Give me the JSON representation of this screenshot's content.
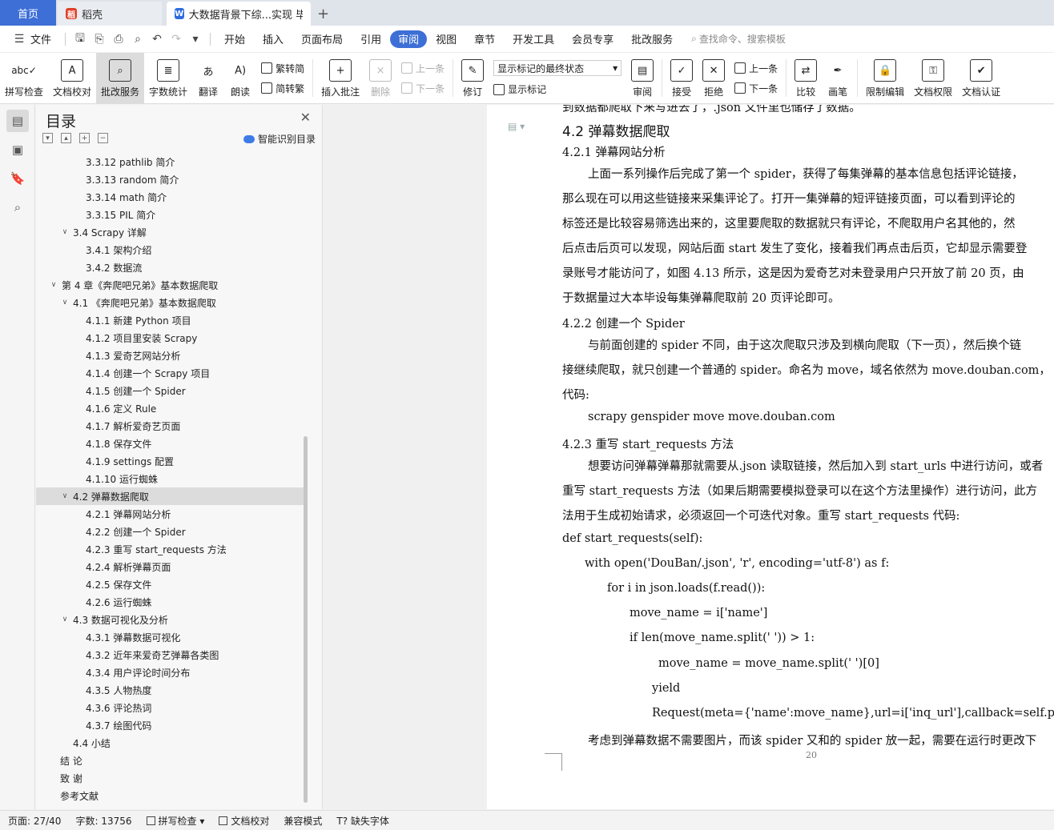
{
  "tabs": {
    "home": "首页",
    "docer": "稻壳",
    "active": "大数据背景下综...实现 毕业论"
  },
  "menu": {
    "file": "文件",
    "items": [
      "开始",
      "插入",
      "页面布局",
      "引用",
      "审阅",
      "视图",
      "章节",
      "开发工具",
      "会员专享",
      "批改服务"
    ],
    "active_index": 4,
    "search_placeholder": "查找命令、搜索模板"
  },
  "ribbon": {
    "spellcheck": "拼写检查",
    "doc_check": "文档校对",
    "review_service": "批改服务",
    "word_count": "字数统计",
    "translate": "翻译",
    "read_aloud": "朗读",
    "trad_to_simp": "繁转简",
    "simp_to_trad": "简转繁",
    "insert_comment": "插入批注",
    "delete": "删除",
    "prev_comment": "上一条",
    "next_comment": "下一条",
    "revise": "修订",
    "display_mode": "显示标记的最终状态",
    "show_marks": "显示标记",
    "review": "审阅",
    "accept": "接受",
    "reject": "拒绝",
    "prev_change": "上一条",
    "next_change": "下一条",
    "compare": "比较",
    "pen": "画笔",
    "restrict_edit": "限制编辑",
    "doc_permission": "文档权限",
    "doc_cert": "文档认证"
  },
  "toc": {
    "title": "目录",
    "smart": "智能识别目录",
    "items": [
      {
        "label": "3.3.12 pathlib 简介",
        "level": 3
      },
      {
        "label": "3.3.13 random 简介",
        "level": 3
      },
      {
        "label": "3.3.14 math 简介",
        "level": 3
      },
      {
        "label": "3.3.15 PIL 简介",
        "level": 3
      },
      {
        "label": "3.4 Scrapy 详解",
        "level": 2,
        "expanded": true
      },
      {
        "label": "3.4.1  架构介绍",
        "level": 3
      },
      {
        "label": "3.4.2  数据流",
        "level": 3
      },
      {
        "label": "第 4 章《奔爬吧兄弟》基本数据爬取",
        "level": 1,
        "expanded": true
      },
      {
        "label": "4.1 《奔爬吧兄弟》基本数据爬取",
        "level": 2,
        "expanded": true
      },
      {
        "label": "4.1.1  新建 Python 项目",
        "level": 3
      },
      {
        "label": "4.1.2  项目里安装 Scrapy",
        "level": 3
      },
      {
        "label": "4.1.3  爱奇艺网站分析",
        "level": 3
      },
      {
        "label": "4.1.4  创建一个 Scrapy 项目",
        "level": 3
      },
      {
        "label": "4.1.5  创建一个 Spider",
        "level": 3
      },
      {
        "label": "4.1.6  定义 Rule",
        "level": 3
      },
      {
        "label": "4.1.7  解析爱奇艺页面",
        "level": 3
      },
      {
        "label": "4.1.8  保存文件",
        "level": 3
      },
      {
        "label": "4.1.9  settings 配置",
        "level": 3
      },
      {
        "label": "4.1.10  运行蜘蛛",
        "level": 3
      },
      {
        "label": "4.2  弹幕数据爬取",
        "level": 2,
        "expanded": true,
        "selected": true
      },
      {
        "label": "4.2.1  弹幕网站分析",
        "level": 3
      },
      {
        "label": "4.2.2  创建一个 Spider",
        "level": 3
      },
      {
        "label": "4.2.3  重写 start_requests 方法",
        "level": 3
      },
      {
        "label": "4.2.4  解析弹幕页面",
        "level": 3
      },
      {
        "label": "4.2.5  保存文件",
        "level": 3
      },
      {
        "label": "4.2.6  运行蜘蛛",
        "level": 3
      },
      {
        "label": "4.3  数据可视化及分析",
        "level": 2,
        "expanded": true
      },
      {
        "label": "4.3.1  弹幕数据可视化",
        "level": 3
      },
      {
        "label": "4.3.2  近年来爱奇艺弹幕各类图",
        "level": 3
      },
      {
        "label": "4.3.4  用户评论时间分布",
        "level": 3
      },
      {
        "label": "4.3.5  人物热度",
        "level": 3
      },
      {
        "label": "4.3.6  评论热词",
        "level": 3
      },
      {
        "label": "4.3.7  绘图代码",
        "level": 3
      },
      {
        "label": "4.4  小结",
        "level": 2
      },
      {
        "label": "结  论",
        "level": 1
      },
      {
        "label": "致  谢",
        "level": 1
      },
      {
        "label": "参考文献",
        "level": 1
      }
    ]
  },
  "doc": {
    "top_cut": "到数据都爬取下来写进去了，.json 文件里也储存了数据。",
    "h2": "4.2  弹幕数据爬取",
    "h3_1": "4.2.1    弹幕网站分析",
    "para1": [
      "上面一系列操作后完成了第一个 spider，获得了每集弹幕的基本信息包括评论链接，",
      "那么现在可以用这些链接来采集评论了。打开一集弹幕的短评链接页面，可以看到评论的",
      "标签还是比较容易筛选出来的，这里要爬取的数据就只有评论，不爬取用户名其他的，然",
      "后点击后页可以发现，网站后面 start 发生了变化，接着我们再点击后页，它却显示需要登",
      "录账号才能访问了，如图 4.13 所示，这是因为爱奇艺对未登录用户只开放了前 20 页，由",
      "于数据量过大本毕设每集弹幕爬取前 20 页评论即可。"
    ],
    "h3_2": "4.2.2    创建一个 Spider",
    "para2": [
      "与前面创建的 spider 不同，由于这次爬取只涉及到横向爬取（下一页），然后换个链",
      "接继续爬取，就只创建一个普通的 spider。命名为 move，域名依然为 move.douban.com，",
      "代码:"
    ],
    "cmd": "scrapy genspider move move.douban.com",
    "h3_3": "4.2.3    重写 start_requests 方法",
    "para3": [
      "想要访问弹幕弹幕那就需要从.json 读取链接，然后加入到 start_urls 中进行访问，或者",
      "重写 start_requests 方法（如果后期需要模拟登录可以在这个方法里操作）进行访问，此方",
      "法用于生成初始请求，必须返回一个可迭代对象。重写 start_requests 代码:"
    ],
    "code": [
      "def start_requests(self):",
      "with open('DouBan/.json', 'r', encoding='utf-8') as f:",
      "for i in json.loads(f.read()):",
      "move_name = i['name']",
      "if len(move_name.split(' ')) > 1:",
      "move_name = move_name.split(' ')[0]",
      "yield",
      "Request(meta={'name':move_name},url=i['inq_url'],callback=self.parse)"
    ],
    "para4": "考虑到弹幕数据不需要图片，而该 spider 又和的 spider 放一起，需要在运行时更改下",
    "page_number": "20"
  },
  "status": {
    "page": "页面: 27/40",
    "words": "字数: 13756",
    "spellcheck": "拼写检查",
    "doc_check": "文档校对",
    "compat": "兼容模式",
    "missing_font": "缺失字体"
  }
}
